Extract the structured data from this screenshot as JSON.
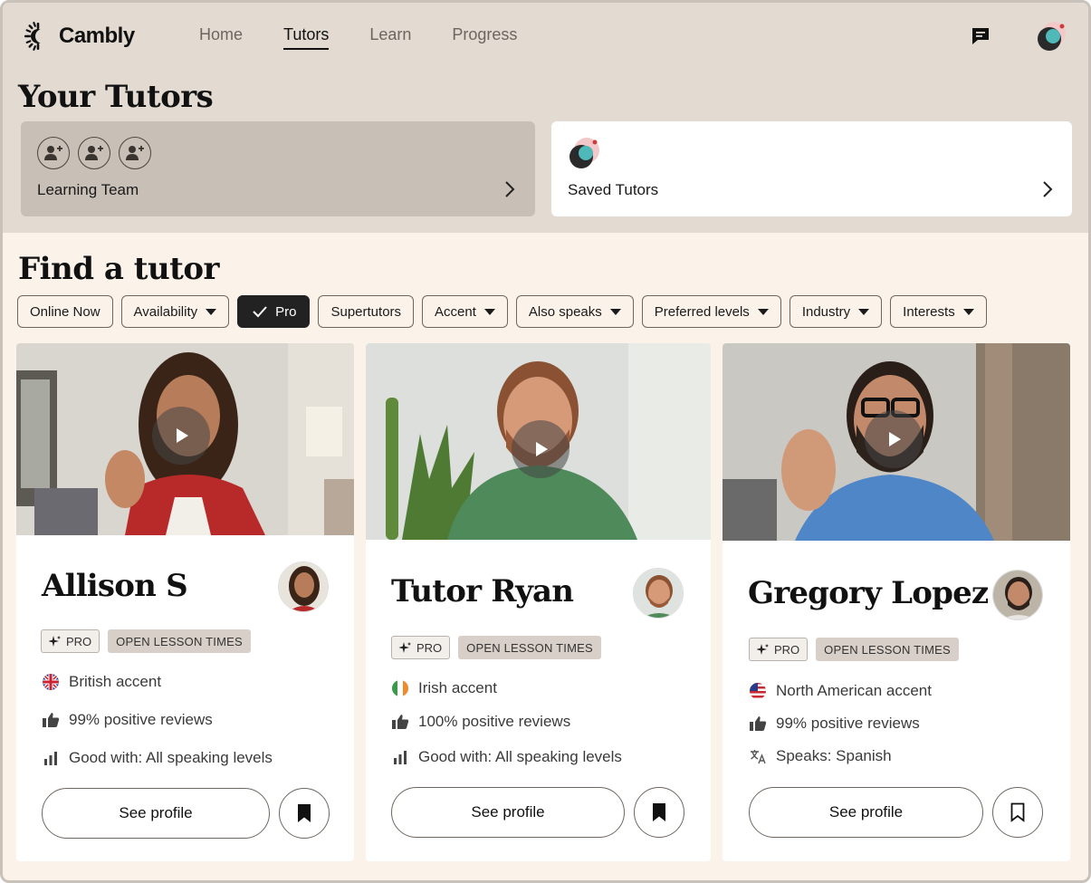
{
  "brand": {
    "name": "Cambly"
  },
  "nav": {
    "items": [
      "Home",
      "Tutors",
      "Learn",
      "Progress"
    ],
    "active": "Tutors"
  },
  "your_tutors": {
    "title": "Your Tutors",
    "learning_team": {
      "label": "Learning Team"
    },
    "saved": {
      "label": "Saved Tutors"
    }
  },
  "find": {
    "title": "Find a tutor",
    "filters": [
      {
        "label": "Online Now",
        "dropdown": false,
        "active": false
      },
      {
        "label": "Availability",
        "dropdown": true,
        "active": false
      },
      {
        "label": "Pro",
        "dropdown": false,
        "active": true
      },
      {
        "label": "Supertutors",
        "dropdown": false,
        "active": false
      },
      {
        "label": "Accent",
        "dropdown": true,
        "active": false
      },
      {
        "label": "Also speaks",
        "dropdown": true,
        "active": false
      },
      {
        "label": "Preferred levels",
        "dropdown": true,
        "active": false
      },
      {
        "label": "Industry",
        "dropdown": true,
        "active": false
      },
      {
        "label": "Interests",
        "dropdown": true,
        "active": false
      }
    ]
  },
  "tutors": [
    {
      "name": "Allison S",
      "badge_pro": "PRO",
      "badge_open": "OPEN LESSON TIMES",
      "accent": "British accent",
      "accent_icon": "uk-flag-icon",
      "reviews": "99% positive reviews",
      "third": "Good with: All speaking levels",
      "third_icon": "bar-chart-icon",
      "see_profile": "See profile",
      "saved": true
    },
    {
      "name": "Tutor Ryan",
      "badge_pro": "PRO",
      "badge_open": "OPEN LESSON TIMES",
      "accent": "Irish accent",
      "accent_icon": "ireland-flag-icon",
      "reviews": "100% positive reviews",
      "third": "Good with: All speaking levels",
      "third_icon": "bar-chart-icon",
      "see_profile": "See profile",
      "saved": true
    },
    {
      "name": "Gregory Lopez",
      "badge_pro": "PRO",
      "badge_open": "OPEN LESSON TIMES",
      "accent": "North American accent",
      "accent_icon": "us-flag-icon",
      "reviews": "99% positive reviews",
      "third": "Speaks: Spanish",
      "third_icon": "translate-icon",
      "see_profile": "See profile",
      "saved": false
    }
  ],
  "colors": {
    "header_bg": "#e3dbd2",
    "page_bg": "#fbf3ea",
    "team_card_bg": "#c8bfb6",
    "active_chip": "#222222",
    "badge_open_bg": "#d8d0c8"
  }
}
